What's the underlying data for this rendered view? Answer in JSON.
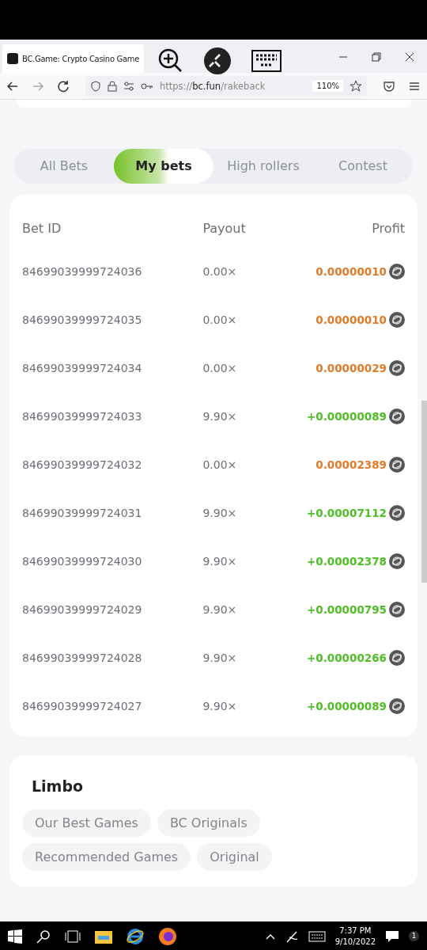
{
  "browser": {
    "tab_title": "BC.Game: Crypto Casino Game",
    "url_scheme": "https://",
    "url_host": "bc.fun",
    "url_path": "/rakeback",
    "zoom": "110%"
  },
  "tabs": [
    {
      "label": "All Bets",
      "selected": false
    },
    {
      "label": "My bets",
      "selected": true
    },
    {
      "label": "High rollers",
      "selected": false
    },
    {
      "label": "Contest",
      "selected": false
    }
  ],
  "table": {
    "columns": [
      "Bet ID",
      "Payout",
      "Profit"
    ],
    "rows": [
      {
        "bet_id": "84699039999724036",
        "payout": "0.00×",
        "profit": "0.00000010",
        "kind": "loss"
      },
      {
        "bet_id": "84699039999724035",
        "payout": "0.00×",
        "profit": "0.00000010",
        "kind": "loss"
      },
      {
        "bet_id": "84699039999724034",
        "payout": "0.00×",
        "profit": "0.00000029",
        "kind": "loss"
      },
      {
        "bet_id": "84699039999724033",
        "payout": "9.90×",
        "profit": "+0.00000089",
        "kind": "win"
      },
      {
        "bet_id": "84699039999724032",
        "payout": "0.00×",
        "profit": "0.00002389",
        "kind": "loss"
      },
      {
        "bet_id": "84699039999724031",
        "payout": "9.90×",
        "profit": "+0.00007112",
        "kind": "win"
      },
      {
        "bet_id": "84699039999724030",
        "payout": "9.90×",
        "profit": "+0.00002378",
        "kind": "win"
      },
      {
        "bet_id": "84699039999724029",
        "payout": "9.90×",
        "profit": "+0.00000795",
        "kind": "win"
      },
      {
        "bet_id": "84699039999724028",
        "payout": "9.90×",
        "profit": "+0.00000266",
        "kind": "win"
      },
      {
        "bet_id": "84699039999724027",
        "payout": "9.90×",
        "profit": "+0.00000089",
        "kind": "win"
      }
    ]
  },
  "game": {
    "title": "Limbo",
    "tags": [
      "Our Best Games",
      "BC Originals",
      "Recommended Games",
      "Original"
    ]
  },
  "taskbar": {
    "time": "7:37 PM",
    "date": "9/10/2022",
    "notifications": "1"
  }
}
